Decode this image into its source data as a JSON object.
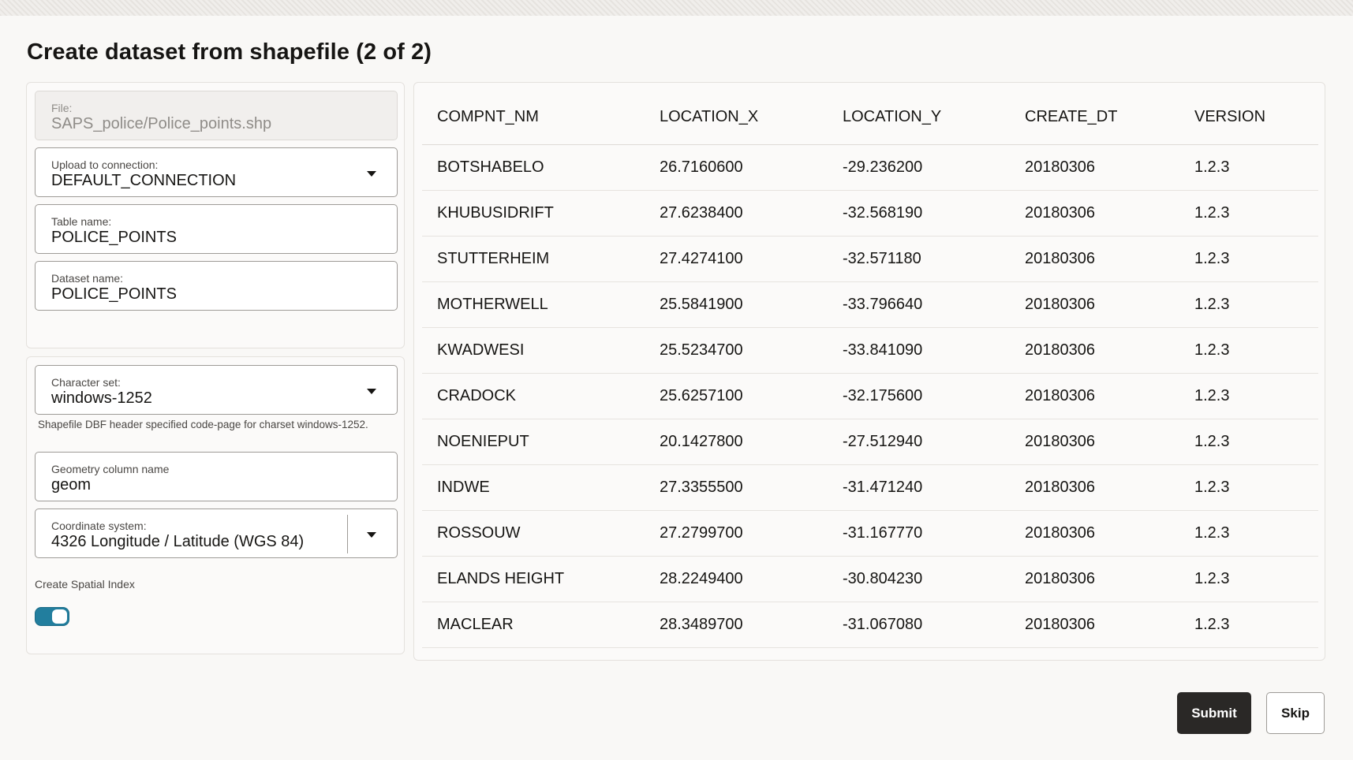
{
  "page": {
    "title": "Create dataset from shapefile (2 of 2)"
  },
  "file": {
    "label": "File:",
    "value": "SAPS_police/Police_points.shp"
  },
  "connection": {
    "label": "Upload to connection:",
    "value": "DEFAULT_CONNECTION"
  },
  "table_name": {
    "label": "Table name:",
    "value": "POLICE_POINTS"
  },
  "dataset_name": {
    "label": "Dataset name:",
    "value": "POLICE_POINTS"
  },
  "charset": {
    "label": "Character set:",
    "value": "windows-1252",
    "helper": "Shapefile DBF header specified code-page for charset windows-1252."
  },
  "geometry": {
    "label": "Geometry column name",
    "value": "geom"
  },
  "coordinate": {
    "label": "Coordinate system:",
    "value": "4326 Longitude / Latitude (WGS 84)"
  },
  "spatial_index": {
    "label": "Create Spatial Index",
    "enabled": true
  },
  "preview": {
    "columns": [
      "COMPNT_NM",
      "LOCATION_X",
      "LOCATION_Y",
      "CREATE_DT",
      "VERSION"
    ],
    "rows": [
      [
        "BOTSHABELO",
        "26.7160600",
        "-29.236200",
        "20180306",
        "1.2.3"
      ],
      [
        "KHUBUSIDRIFT",
        "27.6238400",
        "-32.568190",
        "20180306",
        "1.2.3"
      ],
      [
        "STUTTERHEIM",
        "27.4274100",
        "-32.571180",
        "20180306",
        "1.2.3"
      ],
      [
        "MOTHERWELL",
        "25.5841900",
        "-33.796640",
        "20180306",
        "1.2.3"
      ],
      [
        "KWADWESI",
        "25.5234700",
        "-33.841090",
        "20180306",
        "1.2.3"
      ],
      [
        "CRADOCK",
        "25.6257100",
        "-32.175600",
        "20180306",
        "1.2.3"
      ],
      [
        "NOENIEPUT",
        "20.1427800",
        "-27.512940",
        "20180306",
        "1.2.3"
      ],
      [
        "INDWE",
        "27.3355500",
        "-31.471240",
        "20180306",
        "1.2.3"
      ],
      [
        "ROSSOUW",
        "27.2799700",
        "-31.167770",
        "20180306",
        "1.2.3"
      ],
      [
        "ELANDS HEIGHT",
        "28.2249400",
        "-30.804230",
        "20180306",
        "1.2.3"
      ],
      [
        "MACLEAR",
        "28.3489700",
        "-31.067080",
        "20180306",
        "1.2.3"
      ]
    ]
  },
  "actions": {
    "submit": "Submit",
    "skip": "Skip"
  },
  "colors": {
    "accent": "#227e9e",
    "primary_button": "#2a2826"
  }
}
